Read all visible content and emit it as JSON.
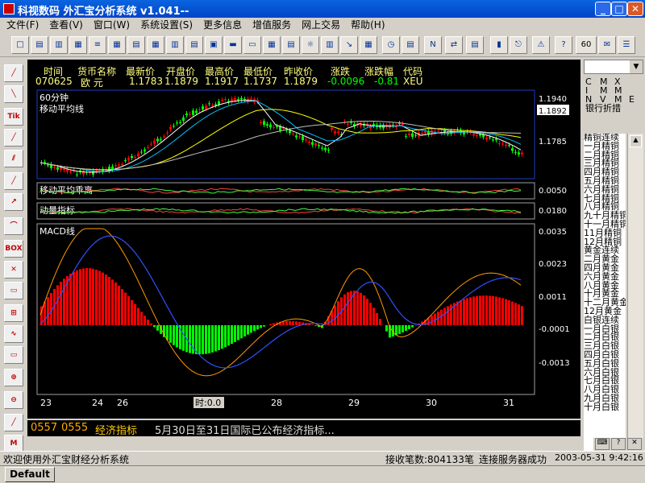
{
  "window": {
    "title": "科视数码  外汇宝分析系统  v1.041--"
  },
  "menu": [
    "文件(F)",
    "查看(V)",
    "窗口(W)",
    "系统设置(S)",
    "更多信息",
    "增值服务",
    "网上交易",
    "帮助(H)"
  ],
  "toolbar": {
    "period_value": "60"
  },
  "quote_header": {
    "labels": [
      "时间",
      "货币名称",
      "最新价",
      "开盘价",
      "最高价",
      "最低价",
      "昨收价",
      "涨跌",
      "涨跌幅",
      "代码"
    ],
    "values": [
      "070625",
      "欧  元",
      "1.1783",
      "1.1879",
      "1.1917",
      "1.1737",
      "1.1879",
      "-0.0096",
      "-0.81",
      "XEU"
    ]
  },
  "main_panel": {
    "title": "60分钟",
    "subtitle": "移动平均线",
    "price_labels": [
      "1.1940",
      "1.1892",
      "1.1785"
    ]
  },
  "ma_dev_panel": {
    "title": "移动平均乖离",
    "value": "0.0050"
  },
  "momentum_panel": {
    "title": "动量指标",
    "value": "0.0180"
  },
  "macd_panel": {
    "title": "MACD线",
    "axis": [
      "0.0035",
      "0.0023",
      "0.0011",
      "-0.0001",
      "-0.0013"
    ]
  },
  "xaxis": [
    "23",
    "24",
    "26",
    "27",
    "28",
    "29",
    "30",
    "31"
  ],
  "crosshair_label": "时:0.0",
  "ticker": {
    "code1": "0557",
    "code2": "0555",
    "category": "经济指标",
    "text": "5月30日至31日国际已公布经济指标..."
  },
  "right_panel": {
    "dropdown_value": "",
    "grid": [
      "C",
      "M",
      "X",
      "I",
      "M",
      "M",
      "N",
      "V",
      "M",
      "E"
    ],
    "category": "银行折措",
    "list": [
      "精铜连续",
      "一月精铜",
      "二月精铜",
      "三月精铜",
      "四月精铜",
      "五月精铜",
      "六月精铜",
      "七月精铜",
      "八月精铜",
      "九十月精铜",
      "十一月精铜",
      "11月精铜",
      "12月精铜",
      "黄金连续",
      "二月黄金",
      "四月黄金",
      "六月黄金",
      "八月黄金",
      "十月黄金",
      "十二月黄金",
      "12月黄金",
      "白银连续",
      "一月白银",
      "二月白银",
      "三月白银",
      "四月白银",
      "五月白银",
      "六月白银",
      "七月白银",
      "八月白银",
      "九月白银",
      "十月白银"
    ]
  },
  "status": {
    "left": "欢迎使用外汇宝财经分析系统",
    "count": "接收笔数:804133笔",
    "server": "连接服务器成功",
    "datetime": "2003-05-31  9:42:16"
  },
  "tab": {
    "label": "Default"
  },
  "colors": {
    "up": "#ff0000",
    "down": "#00ff00",
    "axis_text": "#ffffff",
    "panel_border": "#1c3cbf"
  }
}
